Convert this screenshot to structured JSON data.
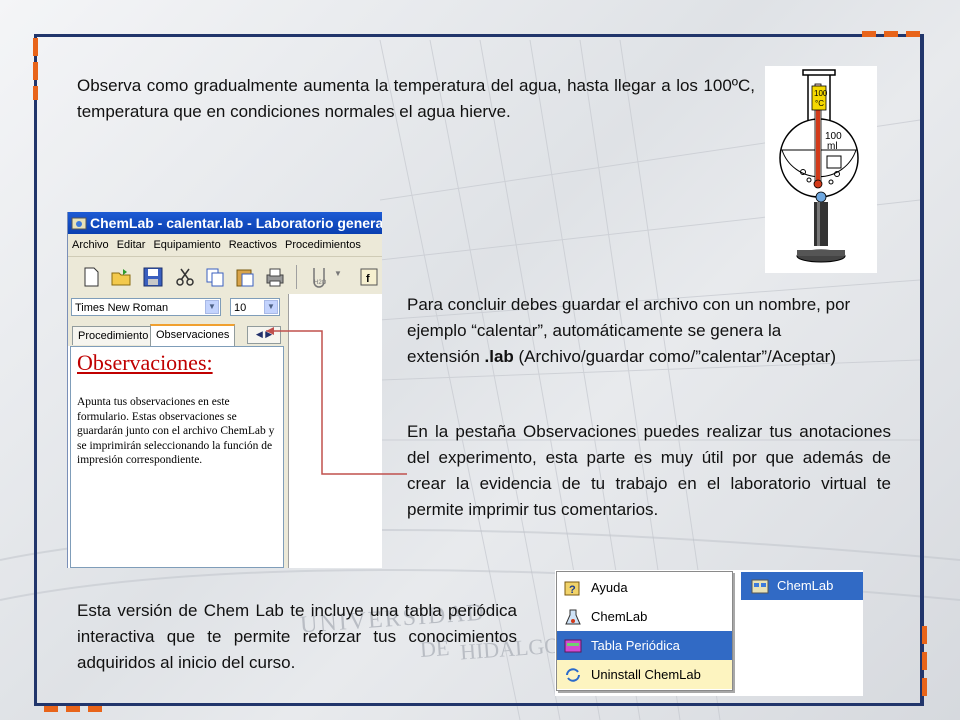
{
  "slide": {
    "paragraph_top": "Observa como gradualmente  aumenta la temperatura del agua, hasta llegar a los 100ºC, temperatura que en condiciones normales el agua hierve.",
    "paragraph_save": [
      "Para concluir debes guardar el archivo con un nombre, por ejemplo “calentar”, automáticamente se genera la extensión ",
      ".lab",
      " (Archivo/guardar como/”calentar”/Aceptar)"
    ],
    "paragraph_obs": "En la pestaña Observaciones puedes realizar tus anotaciones del experimento, esta parte es muy útil por que además de crear la evidencia de tu trabajo en el laboratorio virtual te permite imprimir tus comentarios.",
    "paragraph_table": "Esta versión de Chem Lab te incluye una tabla periódica interactiva que te permite reforzar tus conocimientos adquiridos al inicio del curso.",
    "watermark": [
      "UNIVERSIDAD",
      "DE",
      "HIDALGO"
    ]
  },
  "chemlab_window": {
    "title": "ChemLab - calentar.lab - Laboratorio general",
    "menu": [
      "Archivo",
      "Editar",
      "Equipamiento",
      "Reactivos",
      "Procedimientos"
    ],
    "font_name": "Times New Roman",
    "font_size": "10",
    "tabs": [
      "Procedimiento",
      "Observaciones"
    ],
    "active_tab": "Observaciones",
    "obs_heading": "Observaciones:",
    "obs_body": "Apunta tus observaciones en este formulario. Estas observaciones se guardarán junto con el archivo ChemLab  y se imprimirán seleccionando la función de impresión correspondiente.",
    "toolbar_icons": [
      "new-file-icon",
      "open-folder-icon",
      "save-icon",
      "cut-icon",
      "copy-icon",
      "paste-icon",
      "print-icon",
      "h2o-icon",
      "f-icon"
    ]
  },
  "flask": {
    "thermometer_label": "100\n°C",
    "volume_label": "100\nml"
  },
  "start_menu": {
    "items": [
      "Ayuda",
      "ChemLab",
      "Tabla Periódica",
      "Uninstall ChemLab"
    ],
    "selected": "Tabla Periódica",
    "side_item": "ChemLab",
    "colors": {
      "highlight": "#316ac5",
      "uninstall_bg": "#fdf4c0"
    }
  },
  "colors": {
    "frame": "#21356b",
    "accent": "#e8641a",
    "heading_red": "#c00000",
    "titlebar": "#1d5bd4"
  }
}
